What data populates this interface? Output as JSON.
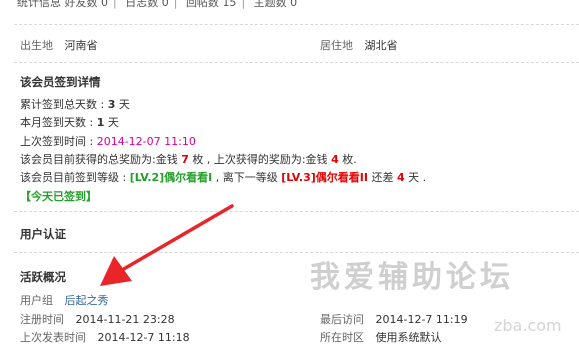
{
  "stats_row": {
    "label": "统计信息",
    "items": [
      {
        "label": "好友数",
        "value": "0"
      },
      {
        "label": "日志数",
        "value": "0"
      },
      {
        "label": "回帖数",
        "value": "15"
      },
      {
        "label": "主题数",
        "value": "0"
      }
    ]
  },
  "profile": {
    "birthplace_label": "出生地",
    "birthplace_value": "河南省",
    "residence_label": "居住地",
    "residence_value": "湖北省"
  },
  "signin": {
    "heading": "该会员签到详情",
    "total_label": "累计签到总天数 : ",
    "total_value": "3",
    "total_unit": " 天",
    "month_label": "本月签到天数 : ",
    "month_value": "1",
    "month_unit": " 天",
    "last_label": "上次签到时间 : ",
    "last_value": "2014-12-07 11:10",
    "reward_pre": "该会员目前获得的总奖励为:金钱 ",
    "reward_total": "7",
    "reward_mid": " 枚 , 上次获得的奖励为:金钱 ",
    "reward_last": "4",
    "reward_post": " 枚.",
    "level_pre": "该会员目前签到等级 : ",
    "level_current": "[LV.2]偶尔看看I",
    "level_mid": " , 离下一等级 ",
    "level_next": "[LV.3]偶尔看看II",
    "level_gap_pre": " 还差 ",
    "level_gap": "4",
    "level_gap_post": " 天 .",
    "today_status": "【今天已签到】"
  },
  "verify": {
    "heading": "用户认证"
  },
  "activity": {
    "heading": "活跃概况",
    "group_label": "用户组",
    "group_value": "后起之秀",
    "reg_label": "注册时间",
    "reg_value": "2014-11-21 23:28",
    "last_visit_label": "最后访问",
    "last_visit_value": "2014-12-7 11:19",
    "last_post_label": "上次发表时间",
    "last_post_value": "2014-12-7 11:18",
    "timezone_label": "所在时区",
    "timezone_value": "使用系统默认"
  },
  "watermark": {
    "title": "我爱辅助论坛",
    "url_fragment": "zba.com"
  },
  "colors": {
    "accent_red": "#e60000",
    "level_green": "#22a02a",
    "time_pink": "#d6009a",
    "link_blue": "#336699",
    "arrow_red": "#e8262a"
  }
}
